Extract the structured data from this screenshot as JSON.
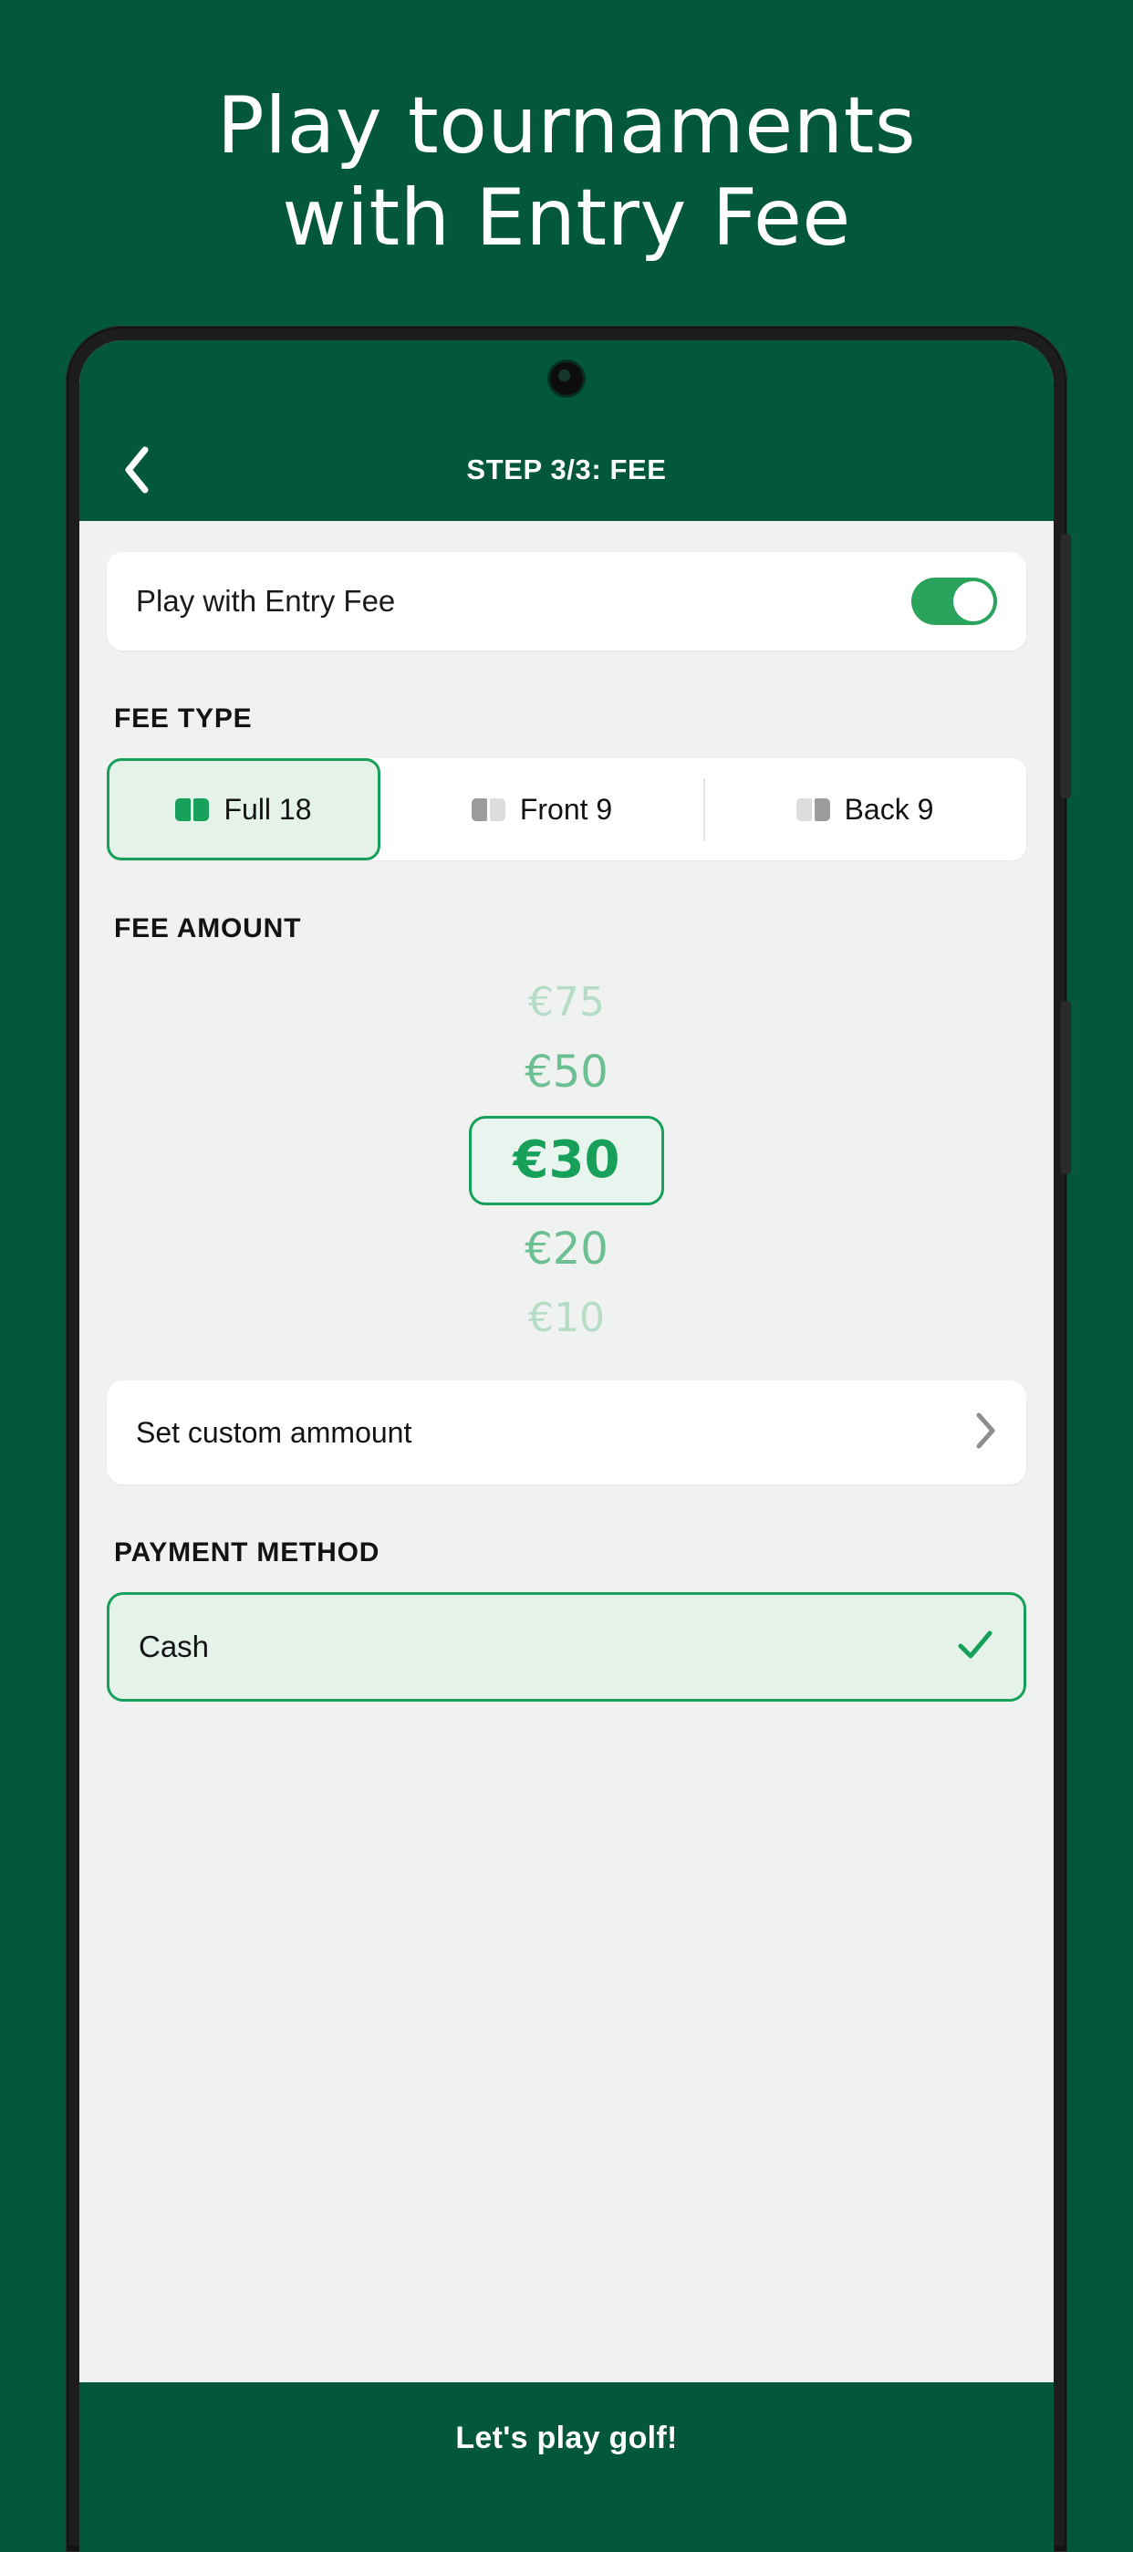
{
  "promo": {
    "headline": "Play  tournaments\nwith Entry Fee"
  },
  "colors": {
    "brand_green": "#03573a",
    "accent_green": "#17a05a",
    "toggle_green": "#2aa45c",
    "screen_bg": "#f0f2f1",
    "card_white": "#ffffff",
    "selected_fill": "#e4f2ea",
    "muted_text": "#b5dcc6"
  },
  "header": {
    "back_icon": "chevron-left-icon",
    "title": "STEP 3/3: FEE"
  },
  "entry_fee_toggle": {
    "label": "Play with Entry Fee",
    "state": "on"
  },
  "fee_type": {
    "section_label": "FEE TYPE",
    "options": [
      {
        "label": "Full 18",
        "icon": "holes-full-icon",
        "selected": true
      },
      {
        "label": "Front 9",
        "icon": "holes-front-icon",
        "selected": false
      },
      {
        "label": "Back 9",
        "icon": "holes-back-icon",
        "selected": false
      }
    ]
  },
  "fee_amount": {
    "section_label": "FEE AMOUNT",
    "options": [
      {
        "label": "€75",
        "selected": false
      },
      {
        "label": "€50",
        "selected": false
      },
      {
        "label": "€30",
        "selected": true
      },
      {
        "label": "€20",
        "selected": false
      },
      {
        "label": "€10",
        "selected": false
      }
    ],
    "custom": {
      "label": "Set custom ammount",
      "chevron": "chevron-right-icon"
    }
  },
  "payment_method": {
    "section_label": "PAYMENT METHOD",
    "options": [
      {
        "label": "Cash",
        "selected": true,
        "check_icon": "check-icon"
      }
    ]
  },
  "cta": {
    "label": "Let's play golf!"
  }
}
